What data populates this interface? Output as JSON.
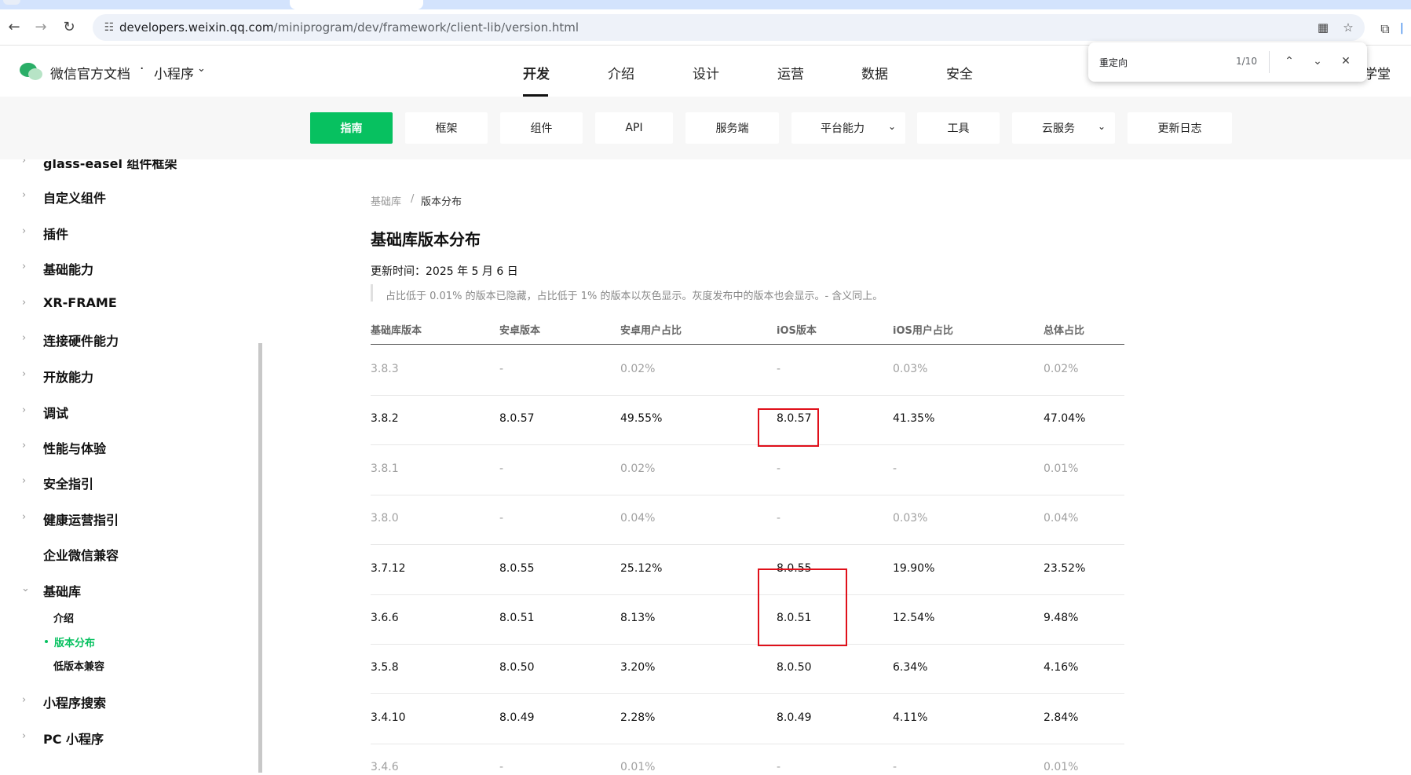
{
  "browser": {
    "url_host": "developers.weixin.qq.com",
    "url_path": "/miniprogram/dev/framework/client-lib/version.html"
  },
  "find": {
    "query": "重定向",
    "count": "1/10"
  },
  "header": {
    "brand": "微信官方文档",
    "separator": "·",
    "product": "小程序",
    "nav": [
      "开发",
      "介绍",
      "设计",
      "运营",
      "数据",
      "安全"
    ],
    "right_partial": "学堂"
  },
  "subnav": {
    "items": [
      "指南",
      "框架",
      "组件",
      "API",
      "服务端",
      "平台能力",
      "工具",
      "云服务",
      "更新日志"
    ]
  },
  "sidebar": {
    "items": [
      "glass-easel 组件框架",
      "自定义组件",
      "插件",
      "基础能力",
      "XR-FRAME",
      "连接硬件能力",
      "开放能力",
      "调试",
      "性能与体验",
      "安全指引",
      "健康运营指引",
      "企业微信兼容",
      "基础库",
      "小程序搜索",
      "PC 小程序"
    ],
    "sub_items": [
      "介绍",
      "版本分布",
      "低版本兼容"
    ]
  },
  "content": {
    "breadcrumb": [
      "基础库",
      "版本分布"
    ],
    "title": "基础库版本分布",
    "updated": "更新时间：2025 年 5 月 6 日",
    "note": "占比低于 0.01% 的版本已隐藏，占比低于 1% 的版本以灰色显示。灰度发布中的版本也会显示。- 含义同上。",
    "columns": [
      "基础库版本",
      "安卓版本",
      "安卓用户占比",
      "iOS版本",
      "iOS用户占比",
      "总体占比"
    ],
    "rows": [
      {
        "cells": [
          "3.8.3",
          "-",
          "0.02%",
          "-",
          "0.03%",
          "0.02%"
        ],
        "grey": true
      },
      {
        "cells": [
          "3.8.2",
          "8.0.57",
          "49.55%",
          "8.0.57",
          "41.35%",
          "47.04%"
        ],
        "grey": false
      },
      {
        "cells": [
          "3.8.1",
          "-",
          "0.02%",
          "-",
          "-",
          "0.01%"
        ],
        "grey": true
      },
      {
        "cells": [
          "3.8.0",
          "-",
          "0.04%",
          "-",
          "0.03%",
          "0.04%"
        ],
        "grey": true
      },
      {
        "cells": [
          "3.7.12",
          "8.0.55",
          "25.12%",
          "8.0.55",
          "19.90%",
          "23.52%"
        ],
        "grey": false
      },
      {
        "cells": [
          "3.6.6",
          "8.0.51",
          "8.13%",
          "8.0.51",
          "12.54%",
          "9.48%"
        ],
        "grey": false
      },
      {
        "cells": [
          "3.5.8",
          "8.0.50",
          "3.20%",
          "8.0.50",
          "6.34%",
          "4.16%"
        ],
        "grey": false
      },
      {
        "cells": [
          "3.4.10",
          "8.0.49",
          "2.28%",
          "8.0.49",
          "4.11%",
          "2.84%"
        ],
        "grey": false
      },
      {
        "cells": [
          "3.4.6",
          "-",
          "0.01%",
          "-",
          "-",
          "0.01%"
        ],
        "grey": true
      }
    ]
  },
  "colors": {
    "accent": "#07c160",
    "highlight": "#e0101a"
  }
}
